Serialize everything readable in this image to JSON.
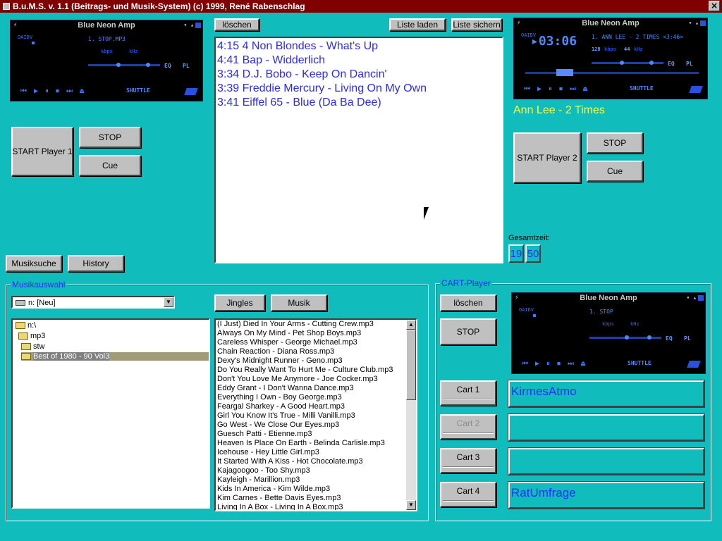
{
  "window": {
    "title": "B.u.M.S. v. 1.1 (Beitrags- und Musik-System)  (c) 1999, René Rabenschlag",
    "close_icon": "×"
  },
  "amp_title": "Blue Neon Amp",
  "amp_labels": {
    "sidebar": "OAIDV",
    "kbps": "kbps",
    "khz": "kHz",
    "eq": "EQ",
    "pl": "PL",
    "shuffle": "SHUTTLE",
    "transport": [
      "⏮",
      "▶",
      "⏸",
      "⏹",
      "⏭",
      "⏏"
    ]
  },
  "player1": {
    "amp_song": "1. STOP.MP3",
    "start_label": "START Player 1",
    "stop_label": "STOP",
    "cue_label": "Cue"
  },
  "player2": {
    "amp_time": "03:06",
    "amp_song": "1. ANN LEE - 2 TIMES <3:46>",
    "amp_kbps": "128",
    "amp_khz": "44",
    "now_playing": "Ann Lee - 2 Times",
    "start_label": "START Player 2",
    "stop_label": "STOP",
    "cue_label": "Cue"
  },
  "playlist": {
    "clear_label": "löschen",
    "load_label": "Liste laden",
    "save_label": "Liste sichern",
    "items": [
      "4:15 4 Non Blondes - What's Up",
      "4:41 Bap - Widderlich",
      "3:34 D.J. Bobo - Keep On Dancin'",
      "3:39 Freddie Mercury - Living On My Own",
      "3:41 Eiffel 65 - Blue (Da Ba Dee)"
    ]
  },
  "total_time": {
    "label": "Gesamtzeit:",
    "minutes": "19",
    "seconds": "50"
  },
  "search": {
    "musiksuche_label": "Musiksuche",
    "history_label": "History"
  },
  "musikauswahl": {
    "legend": "Musikauswahl",
    "drive": "n: [Neu]",
    "jingles_label": "Jingles",
    "musik_label": "Musik",
    "tree": [
      "n:\\",
      "mp3",
      "stw",
      "Best of 1980 - 90 Vol3"
    ],
    "files": [
      "(I Just) Died In Your Arms - Cutting Crew.mp3",
      "Always On My Mind - Pet Shop Boys.mp3",
      "Careless Whisper - George Michael.mp3",
      "Chain Reaction - Diana Ross.mp3",
      "Dexy's Midnight Runner - Geno.mp3",
      "Do You Really Want To Hurt Me - Culture Club.mp3",
      "Don't You Love Me Anymore - Joe Cocker.mp3",
      "Eddy Grant - I Don't Wanna Dance.mp3",
      "Everything I Own - Boy George.mp3",
      "Feargal Sharkey - A Good Heart.mp3",
      "Girl You Know It's True - Milli Vanilli.mp3",
      "Go West - We Close Our Eyes.mp3",
      "Guesch Patti - Etienne.mp3",
      "Heaven Is Place On Earth - Belinda Carlisle.mp3",
      "Icehouse - Hey Little Girl.mp3",
      "It Started With A Kiss - Hot Chocolate.mp3",
      "Kajagoogoo - Too Shy.mp3",
      "Kayleigh - Marillion.mp3",
      "Kids In America - Kim Wilde.mp3",
      "Kim Carnes - Bette Davis Eyes.mp3",
      "Living In A Box - Living In A Box.mp3"
    ]
  },
  "cart": {
    "legend": "CART-Player",
    "amp_song": "1. STOP",
    "clear_label": "löschen",
    "stop_label": "STOP",
    "carts": [
      {
        "label": "Cart 1",
        "content": "KirmesAtmo"
      },
      {
        "label": "Cart 2",
        "content": ""
      },
      {
        "label": "Cart 3",
        "content": ""
      },
      {
        "label": "Cart 4",
        "content": "RatUmfrage"
      }
    ]
  }
}
